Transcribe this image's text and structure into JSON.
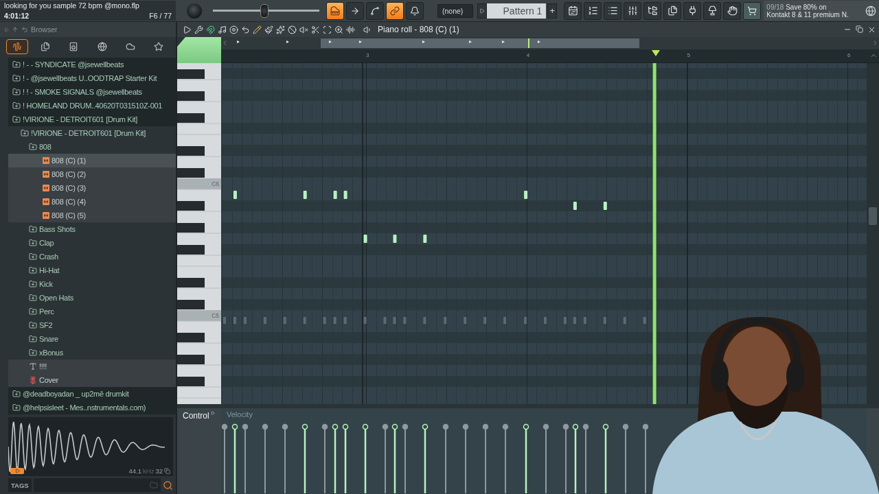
{
  "project": {
    "title": "looking for you sample 72 bpm @mono.flp",
    "time": "4:01:12",
    "counter": "F6 / 77"
  },
  "master_slider": {
    "level": 0.48
  },
  "transport_buttons": [
    {
      "kind": "piano-roll",
      "on": true
    },
    {
      "kind": "arrow",
      "on": false
    },
    {
      "kind": "curve",
      "on": false
    },
    {
      "kind": "link",
      "on": true
    },
    {
      "kind": "metronome",
      "on": false
    }
  ],
  "pattern_selector": {
    "arrangement": "(none)",
    "pattern": "Pattern 1",
    "add_label": "+"
  },
  "news": {
    "date": "09/18",
    "headline": "Save 80% on",
    "detail": "Kontakt 8 & 11 premium N."
  },
  "browser": {
    "title": "Browser",
    "tabs": [
      {
        "kind": "all",
        "selected": true
      },
      {
        "kind": "files",
        "selected": false
      },
      {
        "kind": "plugins",
        "selected": false
      },
      {
        "kind": "web",
        "selected": false
      },
      {
        "kind": "cloud",
        "selected": false
      },
      {
        "kind": "starred",
        "selected": false
      }
    ],
    "tree": [
      {
        "label": "! - - SYNDICATE @jsewellbeats",
        "kind": "folder",
        "selected": false
      },
      {
        "label": "! - @jsewellbeats U..OODTRAP Starter Kit",
        "kind": "folder",
        "selected": false
      },
      {
        "label": "! ! - SMOKE SIGNALS @jsewellbeats",
        "kind": "folder",
        "selected": false
      },
      {
        "label": "! HOMELAND DRUM..40620T031510Z-001",
        "kind": "folder",
        "selected": false
      },
      {
        "label": "!VIRIONE - DETROIT601 [Drum Kit]",
        "kind": "folder",
        "selected": false,
        "children": [
          {
            "label": "!VIRIONE - DETROIT601 [Drum Kit]",
            "kind": "folder",
            "selected": false,
            "children": [
              {
                "label": "808",
                "kind": "folder",
                "selected": false,
                "children": [
                  {
                    "label": "808 (C) (1)",
                    "kind": "audio",
                    "selected": true
                  },
                  {
                    "label": "808 (C) (2)",
                    "kind": "audio",
                    "selected": false
                  },
                  {
                    "label": "808 (C) (3)",
                    "kind": "audio",
                    "selected": false
                  },
                  {
                    "label": "808 (C) (4)",
                    "kind": "audio",
                    "selected": false
                  },
                  {
                    "label": "808 (C) (5)",
                    "kind": "audio",
                    "selected": false
                  }
                ]
              },
              {
                "label": "Bass Shots",
                "kind": "folder",
                "selected": false
              },
              {
                "label": "Clap",
                "kind": "folder",
                "selected": false
              },
              {
                "label": "Crash",
                "kind": "folder",
                "selected": false
              },
              {
                "label": "Hi-Hat",
                "kind": "folder",
                "selected": false
              },
              {
                "label": "Kick",
                "kind": "folder",
                "selected": false
              },
              {
                "label": "Open Hats",
                "kind": "folder",
                "selected": false
              },
              {
                "label": "Perc",
                "kind": "folder",
                "selected": false
              },
              {
                "label": "SF2",
                "kind": "folder",
                "selected": false
              },
              {
                "label": "Snare",
                "kind": "folder",
                "selected": false
              },
              {
                "label": "xBonus",
                "kind": "folder",
                "selected": false
              },
              {
                "label": "!!!!",
                "kind": "text",
                "selected": false
              },
              {
                "label": "Cover",
                "selected": false
              }
            ]
          }
        ]
      },
      {
        "label": "@deadboyadan _ up2mē drumkit",
        "kind": "folder",
        "selected": false
      },
      {
        "label": "@helpsisleet - Mes..nstrumentals.com)",
        "kind": "folder",
        "selected": false
      }
    ],
    "sample_info": {
      "rate": "44.1",
      "unit": "kHz",
      "bits": "32"
    },
    "tags_label": "TAGS"
  },
  "piano_roll": {
    "title": "Piano roll - 808 (C) (1)",
    "ruler": [
      "3",
      "4",
      "5",
      "6"
    ],
    "key_labels": [
      "C6",
      "C5"
    ],
    "control_label": "Control",
    "control_target": "Velocity"
  }
}
